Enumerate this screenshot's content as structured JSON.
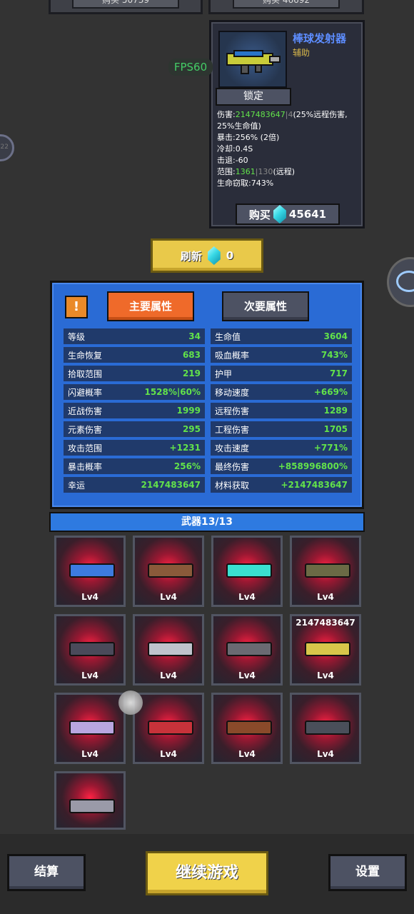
{
  "top_cards": [
    {
      "label": "购买 50739"
    },
    {
      "label": "购买 46692"
    }
  ],
  "item": {
    "name": "棒球发射器",
    "type": "辅助",
    "lock_label": "锁定",
    "stats": {
      "damage_label": "伤害:",
      "damage_value": "2147483647",
      "damage_base": "4",
      "damage_note": "(25%远程伤害, 25%生命值)",
      "crit": "暴击:256% (2倍)",
      "cooldown": "冷却:0.4S",
      "knockback": "击退:-60",
      "range_label": "范围:",
      "range_value": "1361",
      "range_base": "130",
      "range_note": "(远程)",
      "lifesteal": "生命窃取:743%"
    },
    "buy_label": "购买",
    "price": "45641"
  },
  "fps": "FPS60",
  "refresh": {
    "label": "刷新",
    "cost": "0"
  },
  "attributes": {
    "info_icon": "!",
    "tab_main": "主要属性",
    "tab_sub": "次要属性",
    "rows": [
      {
        "label": "等级",
        "value": "34"
      },
      {
        "label": "生命值",
        "value": "3604"
      },
      {
        "label": "生命恢复",
        "value": "683"
      },
      {
        "label": "吸血概率",
        "value": "743%"
      },
      {
        "label": "拾取范围",
        "value": "219"
      },
      {
        "label": "护甲",
        "value": "717"
      },
      {
        "label": "闪避概率",
        "value": "1528%|60%"
      },
      {
        "label": "移动速度",
        "value": "+669%"
      },
      {
        "label": "近战伤害",
        "value": "1999"
      },
      {
        "label": "远程伤害",
        "value": "1289"
      },
      {
        "label": "元素伤害",
        "value": "295"
      },
      {
        "label": "工程伤害",
        "value": "1705"
      },
      {
        "label": "攻击范围",
        "value": "+1231"
      },
      {
        "label": "攻击速度",
        "value": "+771%"
      },
      {
        "label": "暴击概率",
        "value": "256%"
      },
      {
        "label": "最终伤害",
        "value": "+858996800%"
      },
      {
        "label": "幸运",
        "value": "2147483647"
      },
      {
        "label": "材料获取",
        "value": "+2147483647"
      }
    ]
  },
  "weapons": {
    "header": "武器13/13",
    "items": [
      {
        "level": "Lv4",
        "count": "",
        "color": "#3d7be0"
      },
      {
        "level": "Lv4",
        "count": "",
        "color": "#8a5a3a"
      },
      {
        "level": "Lv4",
        "count": "",
        "color": "#3ae0d0"
      },
      {
        "level": "Lv4",
        "count": "",
        "color": "#6b6a45"
      },
      {
        "level": "Lv4",
        "count": "",
        "color": "#4a4a5a"
      },
      {
        "level": "Lv4",
        "count": "",
        "color": "#bfc3cc"
      },
      {
        "level": "Lv4",
        "count": "",
        "color": "#6a6a72"
      },
      {
        "level": "Lv4",
        "count": "2147483647",
        "color": "#d8c64a"
      },
      {
        "level": "Lv4",
        "count": "",
        "color": "#b9a6e0"
      },
      {
        "level": "Lv4",
        "count": "",
        "color": "#c8323a"
      },
      {
        "level": "Lv4",
        "count": "",
        "color": "#8a4a2a"
      },
      {
        "level": "Lv4",
        "count": "",
        "color": "#4a4f5a"
      },
      {
        "level": "",
        "count": "",
        "color": "#9a9aa8"
      }
    ]
  },
  "bottom": {
    "settle": "结算",
    "continue": "继续游戏",
    "settings": "设置"
  }
}
